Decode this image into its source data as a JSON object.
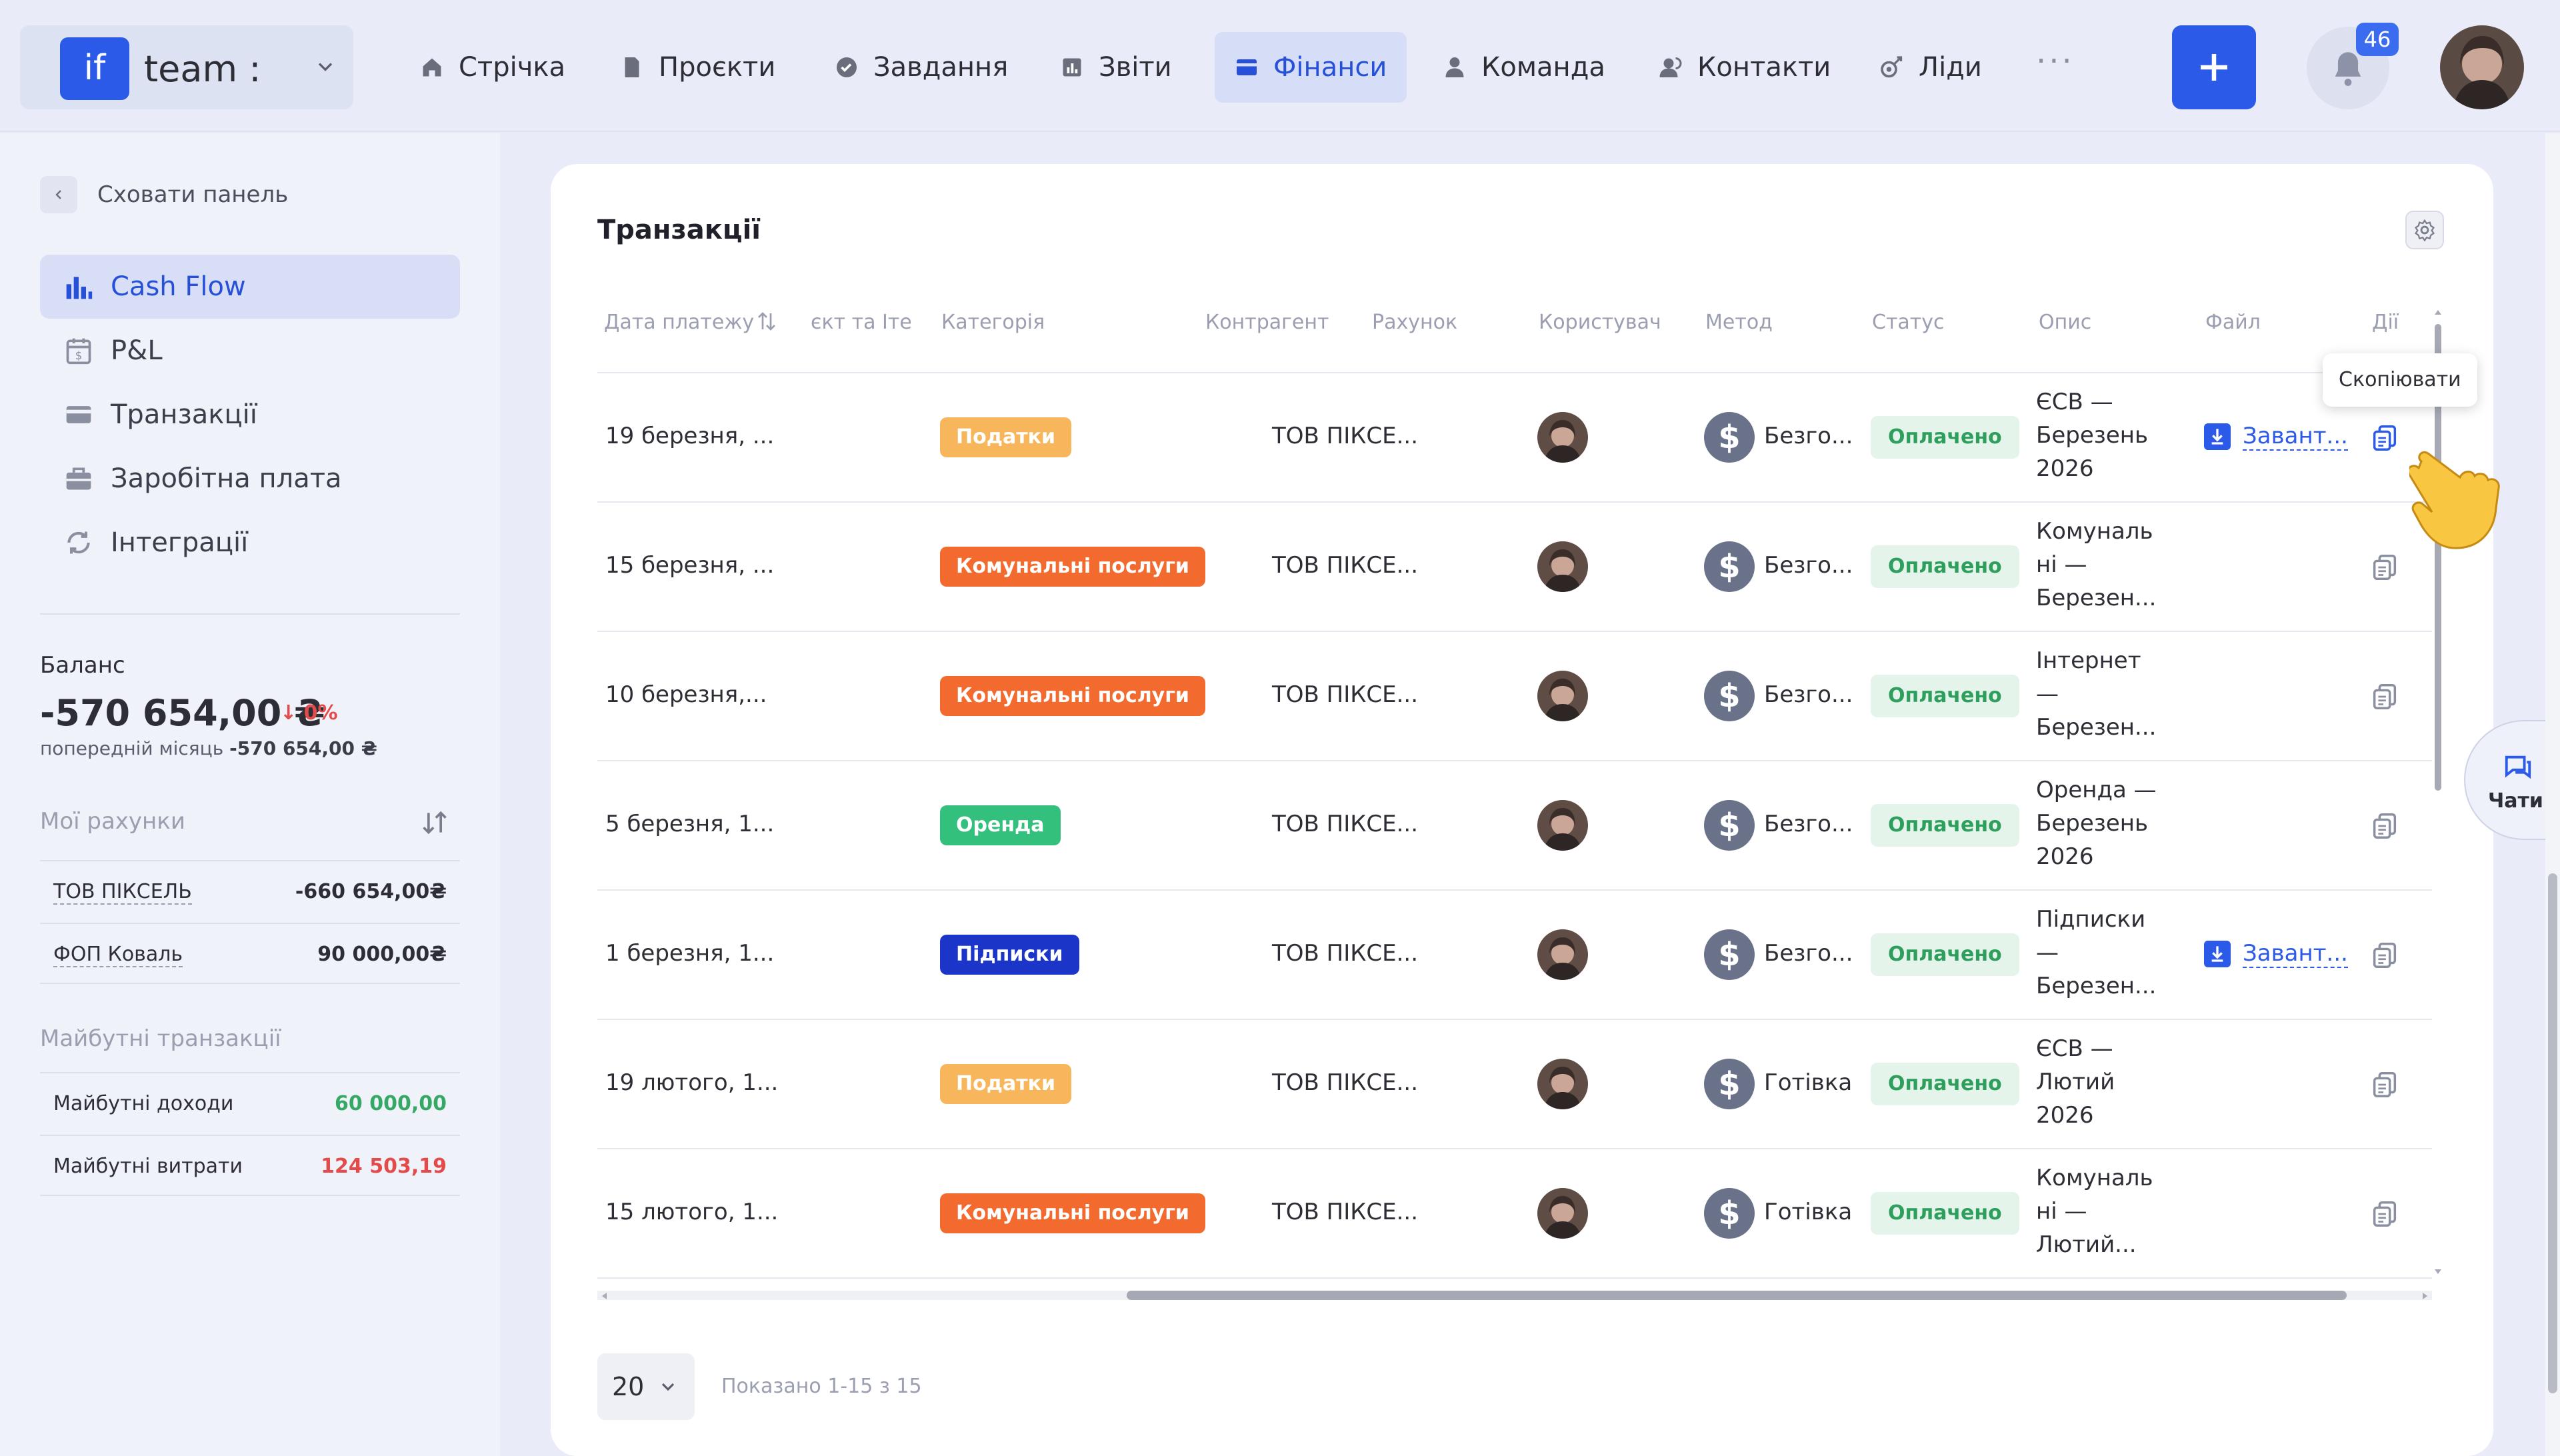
{
  "workspace": {
    "logo": "if",
    "name": "team :"
  },
  "nav": [
    {
      "label": "Стрічка",
      "icon": "home-icon"
    },
    {
      "label": "Проєкти",
      "icon": "document-icon"
    },
    {
      "label": "Завдання",
      "icon": "check-circle-icon"
    },
    {
      "label": "Звіти",
      "icon": "report-icon"
    },
    {
      "label": "Фінанси",
      "icon": "wallet-icon",
      "active": true
    },
    {
      "label": "Команда",
      "icon": "user-icon"
    },
    {
      "label": "Контакти",
      "icon": "contacts-icon"
    },
    {
      "label": "Ліди",
      "icon": "leads-icon"
    }
  ],
  "nav_more": "···",
  "notifications": {
    "count": "46"
  },
  "sidebar": {
    "hide_label": "Сховати панель",
    "items": [
      {
        "label": "Cash Flow",
        "icon": "chart-bars-icon",
        "active": true
      },
      {
        "label": "P&L",
        "icon": "calendar-dollar-icon"
      },
      {
        "label": "Транзакції",
        "icon": "card-icon"
      },
      {
        "label": "Заробітна плата",
        "icon": "briefcase-icon"
      },
      {
        "label": "Інтеграції",
        "icon": "sync-icon"
      }
    ],
    "balance": {
      "label": "Баланс",
      "value": "-570 654,00 ₴",
      "change": "↓ 0%",
      "prev_label": "попередній місяць",
      "prev_value": "-570 654,00 ₴"
    },
    "accounts_title": "Мої рахунки",
    "accounts": [
      {
        "name": "ТОВ ПІКСЕЛЬ",
        "value": "-660 654,00₴"
      },
      {
        "name": "ФОП Коваль",
        "value": "90 000,00₴"
      }
    ],
    "future_title": "Майбутні транзакції",
    "future": [
      {
        "name": "Майбутні доходи",
        "value": "60 000,00"
      },
      {
        "name": "Майбутні витрати",
        "value": "124 503,19"
      }
    ]
  },
  "table": {
    "title": "Транзакції",
    "headers": [
      "Дата платежу",
      "єкт та Іте...",
      "Категорія",
      "Контрагент",
      "Рахунок",
      "Користувач",
      "Метод",
      "Статус",
      "Опис",
      "Файл",
      "Дії"
    ],
    "rows": [
      {
        "date": "19 березня, ...",
        "category": "Податки",
        "cat": "tax",
        "account": "ТОВ ПІКСЕ...",
        "method": "Безго...",
        "status": "Оплачено",
        "desc": [
          "ЄСВ —",
          "Березень",
          "2026"
        ],
        "file": "Завант..."
      },
      {
        "date": "15 березня, ...",
        "category": "Комунальні послуги",
        "cat": "util",
        "account": "ТОВ ПІКСЕ...",
        "method": "Безго...",
        "status": "Оплачено",
        "desc": [
          "Комуналь",
          "ні —",
          "Березен..."
        ],
        "file": ""
      },
      {
        "date": "10 березня,...",
        "category": "Комунальні послуги",
        "cat": "util",
        "account": "ТОВ ПІКСЕ...",
        "method": "Безго...",
        "status": "Оплачено",
        "desc": [
          "Інтернет",
          "—",
          "Березен..."
        ],
        "file": ""
      },
      {
        "date": "5 березня, 1...",
        "category": "Оренда",
        "cat": "rent",
        "account": "ТОВ ПІКСЕ...",
        "method": "Безго...",
        "status": "Оплачено",
        "desc": [
          "Оренда —",
          "Березень",
          "2026"
        ],
        "file": ""
      },
      {
        "date": "1 березня, 1...",
        "category": "Підписки",
        "cat": "subs",
        "account": "ТОВ ПІКСЕ...",
        "method": "Безго...",
        "status": "Оплачено",
        "desc": [
          "Підписки",
          "—",
          "Березен..."
        ],
        "file": "Завант..."
      },
      {
        "date": "19 лютого, 1...",
        "category": "Податки",
        "cat": "tax",
        "account": "ТОВ ПІКСЕ...",
        "method": "Готівка",
        "status": "Оплачено",
        "desc": [
          "ЄСВ —",
          "Лютий",
          "2026"
        ],
        "file": ""
      },
      {
        "date": "15 лютого, 1...",
        "category": "Комунальні послуги",
        "cat": "util",
        "account": "ТОВ ПІКСЕ...",
        "method": "Готівка",
        "status": "Оплачено",
        "desc": [
          "Комуналь",
          "ні —",
          "Лютий..."
        ],
        "file": ""
      }
    ]
  },
  "pagination": {
    "page_size": "20",
    "info": "Показано 1-15 з 15"
  },
  "tooltip": "Скопіювати",
  "chats_label": "Чати",
  "colors": {
    "accent": "#2b59e8",
    "tax": "#f8b65c",
    "util": "#f26a2e",
    "rent": "#33c07c",
    "subs": "#1b35c8",
    "paid": "#2e9e5c"
  }
}
